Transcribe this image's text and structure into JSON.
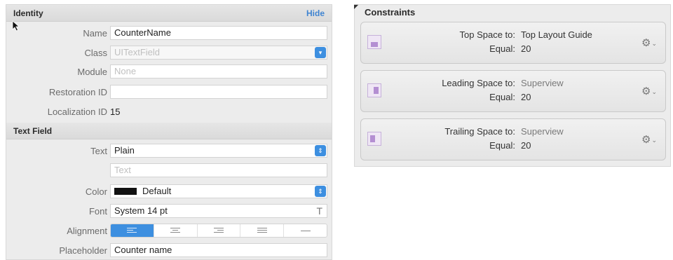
{
  "identity": {
    "header": "Identity",
    "hide_label": "Hide",
    "rows": [
      {
        "label": "Name",
        "value": "CounterName"
      },
      {
        "label": "Class",
        "value": "UITextField"
      },
      {
        "label": "Module",
        "value": "None"
      },
      {
        "label": "Restoration ID",
        "value": ""
      },
      {
        "label": "Localization ID",
        "value": "15"
      }
    ]
  },
  "text_field": {
    "header": "Text Field",
    "text_label": "Text",
    "text_value": "Plain",
    "text_placeholder": "Text",
    "color_label": "Color",
    "color_value": "Default",
    "font_label": "Font",
    "font_value": "System 14 pt",
    "font_icon": "T",
    "alignment_label": "Alignment",
    "alignment_options": [
      "left",
      "center",
      "right",
      "justified",
      "natural"
    ],
    "alignment_selected": "left",
    "placeholder_label": "Placeholder",
    "placeholder_value": "Counter name"
  },
  "constraints": {
    "title": "Constraints",
    "items": [
      {
        "name_key": "Top Space to:",
        "name_value": "Top Layout Guide",
        "relation_key": "Equal:",
        "relation_value": "20"
      },
      {
        "name_key": "Leading Space to:",
        "name_value": "Superview",
        "relation_key": "Equal:",
        "relation_value": "20"
      },
      {
        "name_key": "Trailing Space to:",
        "name_value": "Superview",
        "relation_key": "Equal:",
        "relation_value": "20"
      }
    ]
  },
  "colors": {
    "accent": "#3d8fe0",
    "link": "#3f84d1",
    "constraint_icon": "#b48fd2"
  }
}
